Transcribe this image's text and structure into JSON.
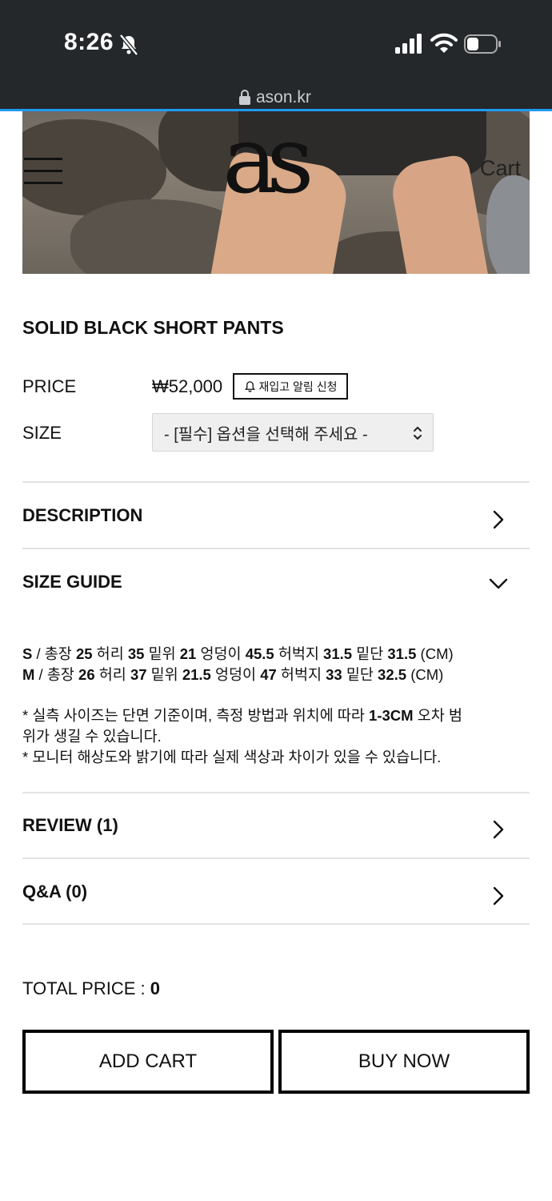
{
  "status_bar": {
    "time": "8:26"
  },
  "browser": {
    "url": "ason.kr"
  },
  "header": {
    "logo": "as",
    "cart_label": "Cart"
  },
  "product": {
    "title": "SOLID BLACK SHORT PANTS",
    "price_label": "PRICE",
    "price": "₩52,000",
    "restock_button": "재입고 알림 신청",
    "size_label": "SIZE",
    "size_select": "- [필수] 옵션을 선택해 주세요 -"
  },
  "sections": {
    "description": "DESCRIPTION",
    "size_guide": "SIZE GUIDE",
    "review": "REVIEW (1)",
    "qa": "Q&A (0)"
  },
  "size_guide": {
    "s_size": "S",
    "m_size": "M",
    "length_label": "총장",
    "waist_label": "허리",
    "rise_label": "밑위",
    "hip_label": "엉덩이",
    "thigh_label": "허벅지",
    "hem_label": "밑단",
    "unit": "(CM)",
    "s": {
      "length": "25",
      "waist": "35",
      "rise": "21",
      "hip": "45.5",
      "thigh": "31.5",
      "hem": "31.5"
    },
    "m": {
      "length": "26",
      "waist": "37",
      "rise": "21.5",
      "hip": "47",
      "thigh": "33",
      "hem": "32.5"
    },
    "note1_pre": "* 실측 사이즈는 단면 기준이며, 측정 방법과 위치에 따라 ",
    "note1_bold": "1-3CM",
    "note1_post": " 오차 범",
    "note1_line2": "위가 생길 수 있습니다.",
    "note2": "* 모니터 해상도와 밝기에 따라 실제 색상과 차이가 있을 수 있습니다."
  },
  "footer": {
    "total_label": "TOTAL PRICE : ",
    "total_value": "0",
    "add_cart": "ADD CART",
    "buy_now": "BUY NOW"
  }
}
